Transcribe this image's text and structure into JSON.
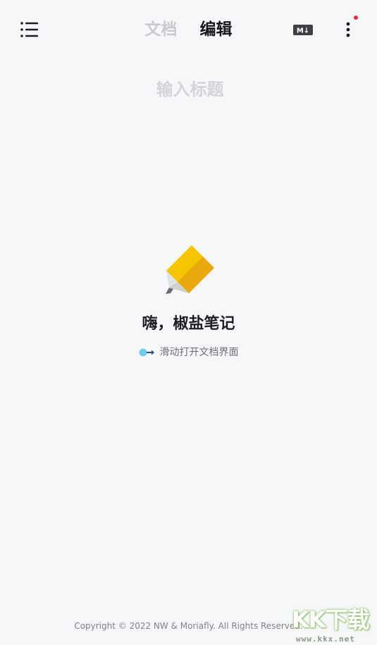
{
  "colors": {
    "background": "#f6f7f9",
    "tab_active": "#16171a",
    "tab_inactive": "#c9cacd",
    "notify_dot": "#e8303a",
    "pencil_yellow": "#f6c400",
    "pencil_orange": "#e9a80c",
    "hint_dot": "#6fcdf5",
    "hint_arrow": "#2b4e8a"
  },
  "header": {
    "menu_icon": "list-menu-icon",
    "tabs": [
      {
        "label": "文档",
        "active": false
      },
      {
        "label": "编辑",
        "active": true
      }
    ],
    "markdown_icon": "markdown-icon",
    "markdown_label": "M↓",
    "more_icon": "vertical-dots-icon",
    "has_notification": true
  },
  "editor": {
    "title_placeholder": "输入标题",
    "title_value": ""
  },
  "empty_state": {
    "icon": "pencil-icon",
    "heading": "嗨，椒盐笔记",
    "hint_icon": "swipe-icon",
    "hint": "滑动打开文档界面"
  },
  "footer": {
    "copyright": "Copyright © 2022 NW & Moriafly. All Rights Reserved."
  },
  "watermark": {
    "letters": "KK下载",
    "url": "www.kkx.net"
  }
}
